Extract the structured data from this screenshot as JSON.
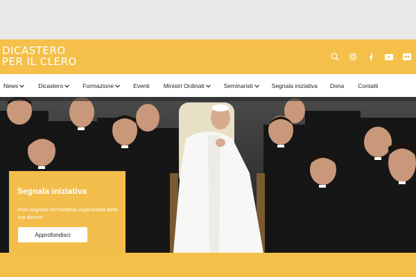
{
  "header": {
    "logo_line1": "DICASTERO",
    "logo_line2": "PER IL CLERO",
    "icons": [
      "search-icon",
      "instagram-icon",
      "facebook-icon",
      "youtube-icon",
      "flickr-icon"
    ]
  },
  "nav": {
    "items": [
      {
        "label": "News",
        "dropdown": true
      },
      {
        "label": "Dicastero",
        "dropdown": true
      },
      {
        "label": "Formazione",
        "dropdown": true
      },
      {
        "label": "Eventi",
        "dropdown": false
      },
      {
        "label": "Ministri Ordinati",
        "dropdown": true
      },
      {
        "label": "Seminaristi",
        "dropdown": true
      },
      {
        "label": "Segnala iniziativa",
        "dropdown": false
      },
      {
        "label": "Dona",
        "dropdown": false
      },
      {
        "label": "Contatti",
        "dropdown": false
      }
    ]
  },
  "hero_card": {
    "title": "Segnala iniziativa",
    "text": "Puoi segnare un'iniziativa organizzata dalla tua diocesi",
    "button_label": "Approfondisci"
  },
  "colors": {
    "accent": "#f4c04a",
    "nav_bg": "#ffffff",
    "page_bg": "#e9e9e9"
  }
}
